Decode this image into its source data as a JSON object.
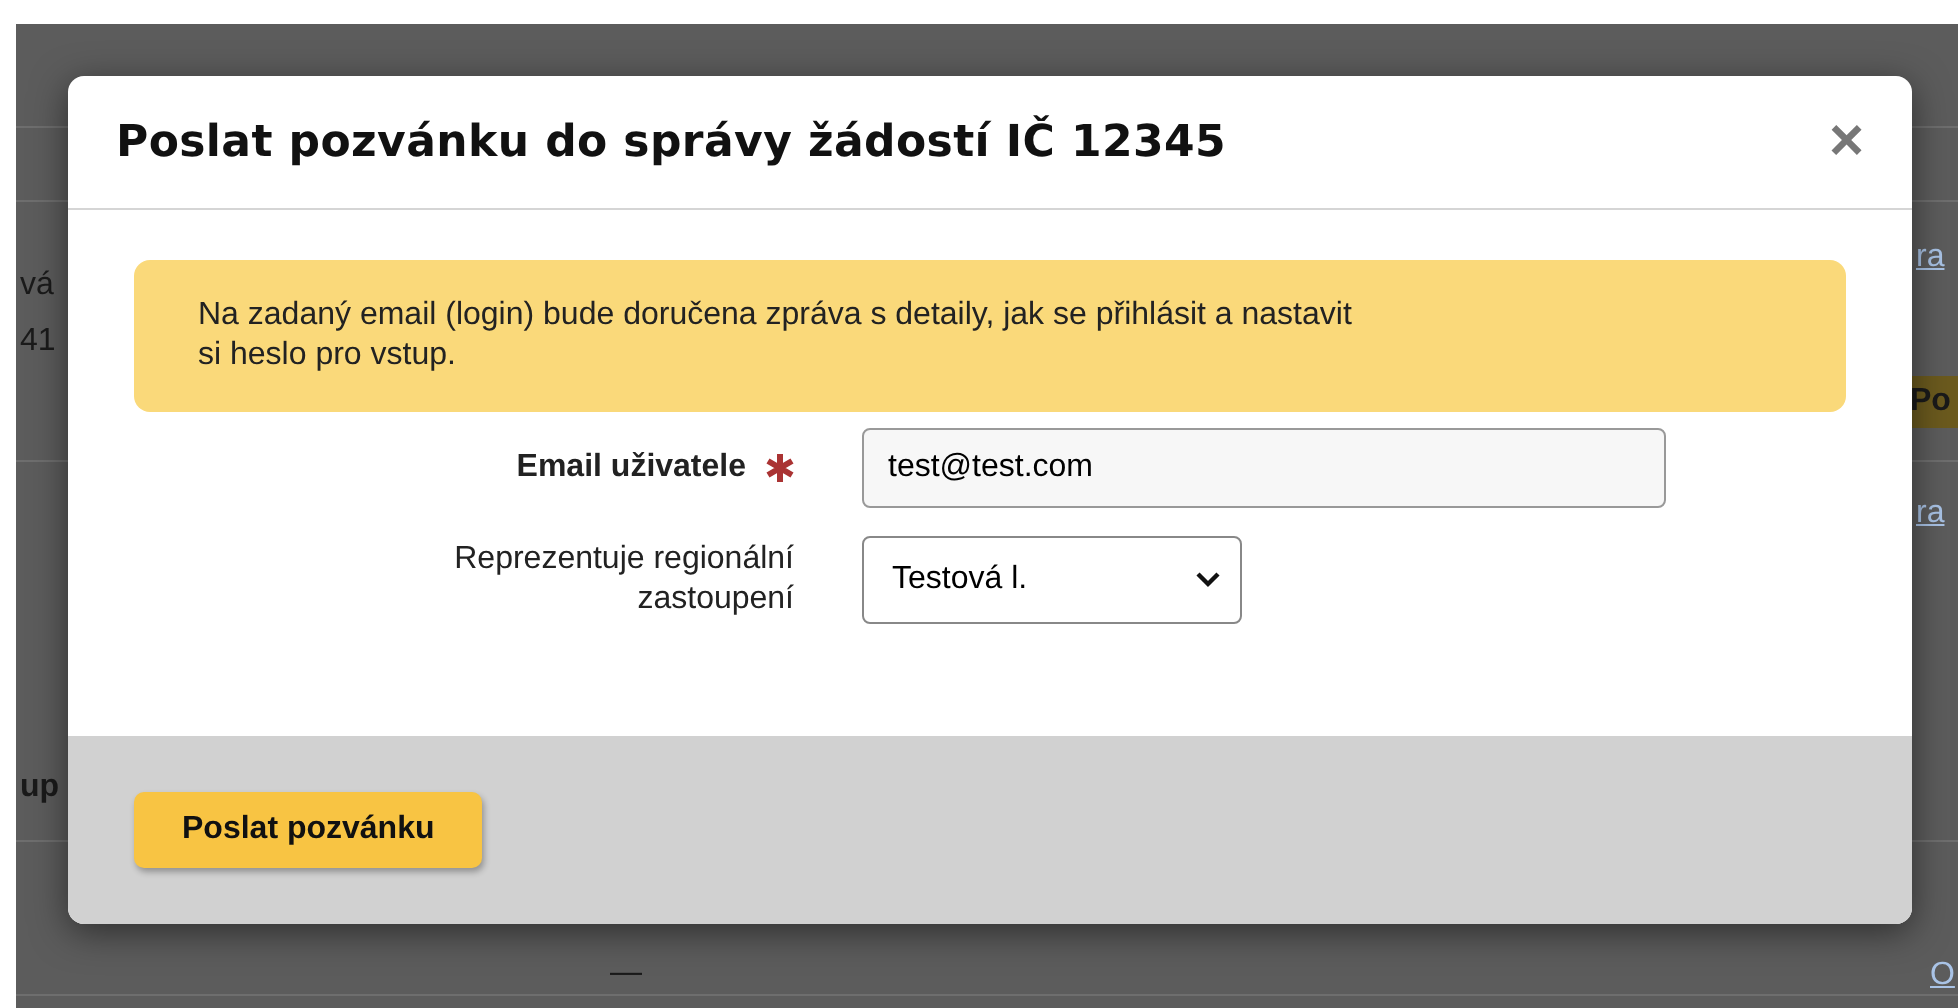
{
  "background_page": [
    {
      "kind": "text",
      "text": "vá"
    },
    {
      "kind": "text",
      "text": "41"
    },
    {
      "kind": "link",
      "text": "ra"
    },
    {
      "kind": "tag",
      "text": "Po"
    },
    {
      "kind": "link",
      "text": "ra"
    },
    {
      "kind": "heading",
      "text": "up"
    },
    {
      "kind": "text",
      "text": "—"
    },
    {
      "kind": "link",
      "text": "O"
    }
  ],
  "dialog": {
    "title": "Poslat pozvánku do správy žádostí IČ 12345",
    "close": "×",
    "notice": "Na zadaný email (login) bude doručena zpráva s detaily, jak se přihlásit a nastavit si heslo pro vstup.",
    "fields": [
      {
        "kind": "input",
        "label": "Email uživatele",
        "required": true,
        "value": "test@test.com"
      },
      {
        "kind": "select",
        "label": "Reprezentuje regionální zastoupení",
        "required": false,
        "value": "Testová l."
      }
    ],
    "submit": "Poslat pozvánku"
  }
}
